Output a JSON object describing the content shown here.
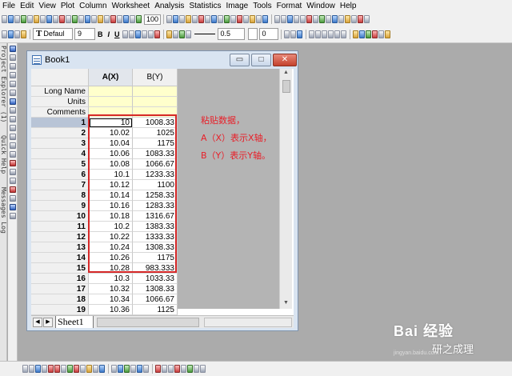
{
  "menu": [
    "File",
    "Edit",
    "View",
    "Plot",
    "Column",
    "Worksheet",
    "Analysis",
    "Statistics",
    "Image",
    "Tools",
    "Format",
    "Window",
    "Help"
  ],
  "toolbar": {
    "zoom": "100",
    "font_name": "Defaul",
    "font_size": "9",
    "line_width": "0.5",
    "number_value": "0",
    "bold": "B",
    "italic": "I",
    "underline": "U"
  },
  "window": {
    "title": "Book1",
    "minimize": "▭",
    "maximize": "□",
    "close": "✕"
  },
  "sheet": {
    "columns": [
      {
        "name": "A(X)"
      },
      {
        "name": "B(Y)"
      }
    ],
    "meta_rows": [
      "Long Name",
      "Units",
      "Comments"
    ],
    "rows": [
      {
        "n": "1",
        "a": "10",
        "b": "1008.33"
      },
      {
        "n": "2",
        "a": "10.02",
        "b": "1025"
      },
      {
        "n": "3",
        "a": "10.04",
        "b": "1175"
      },
      {
        "n": "4",
        "a": "10.06",
        "b": "1083.33"
      },
      {
        "n": "5",
        "a": "10.08",
        "b": "1066.67"
      },
      {
        "n": "6",
        "a": "10.1",
        "b": "1233.33"
      },
      {
        "n": "7",
        "a": "10.12",
        "b": "1100"
      },
      {
        "n": "8",
        "a": "10.14",
        "b": "1258.33"
      },
      {
        "n": "9",
        "a": "10.16",
        "b": "1283.33"
      },
      {
        "n": "10",
        "a": "10.18",
        "b": "1316.67"
      },
      {
        "n": "11",
        "a": "10.2",
        "b": "1383.33"
      },
      {
        "n": "12",
        "a": "10.22",
        "b": "1333.33"
      },
      {
        "n": "13",
        "a": "10.24",
        "b": "1308.33"
      },
      {
        "n": "14",
        "a": "10.26",
        "b": "1175"
      },
      {
        "n": "15",
        "a": "10.28",
        "b": "983.333"
      },
      {
        "n": "16",
        "a": "10.3",
        "b": "1033.33"
      },
      {
        "n": "17",
        "a": "10.32",
        "b": "1308.33"
      },
      {
        "n": "18",
        "a": "10.34",
        "b": "1066.67"
      },
      {
        "n": "19",
        "a": "10.36",
        "b": "1125"
      }
    ],
    "tab": "Sheet1"
  },
  "side_labels": [
    "Project Explorer (1)",
    "Quick Help",
    "Messages Log"
  ],
  "annotation": [
    "粘贴数据，",
    "A（X）表示X轴，",
    "B（Y）表示Y轴。"
  ],
  "watermark": {
    "brand": "Bai 经验",
    "sub": "研之成理",
    "url": "jingyan.baidu.com"
  },
  "colors": {
    "annotation": "#e8202a",
    "selection_border": "#d62828",
    "meta_fill": "#ffffcc",
    "close_button": "#c4412d"
  }
}
